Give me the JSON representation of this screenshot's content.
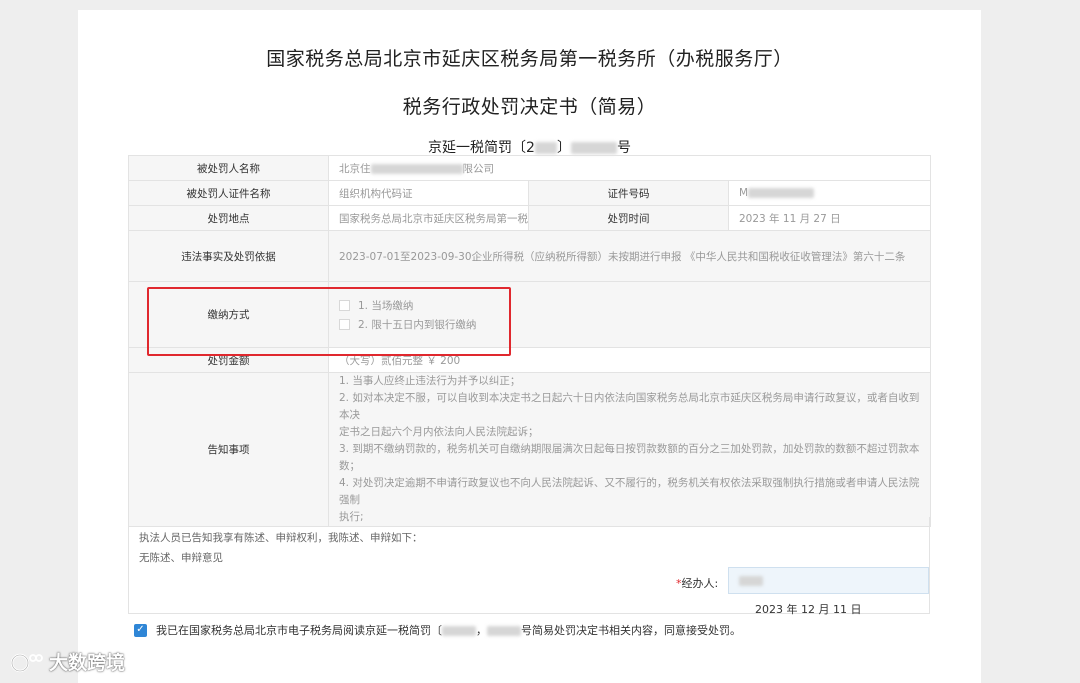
{
  "header": {
    "office": "国家税务总局北京市延庆区税务局第一税务所（办税服务厅）",
    "doc_title": "税务行政处罚决定书（简易）",
    "doc_no_prefix": "京延一税简罚〔2",
    "doc_no_suffix": "号"
  },
  "form": {
    "name_label": "被处罚人名称",
    "name_prefix": "北京住",
    "name_suffix": "限公司",
    "cert_name_label": "被处罚人证件名称",
    "cert_name_value": "组织机构代码证",
    "cert_no_label": "证件号码",
    "cert_no_prefix": "M",
    "place_label": "处罚地点",
    "place_value": "国家税务总局北京市延庆区税务局第一税务",
    "time_label": "处罚时间",
    "time_value": "2023 年 11 月 27 日",
    "violation_label": "违法事实及处罚依据",
    "violation_value": "2023-07-01至2023-09-30企业所得税（应纳税所得额）未按期进行申报 《中华人民共和国税收征收管理法》第六十二条",
    "pay_label": "缴纳方式",
    "pay_options": [
      "1. 当场缴纳",
      "2. 限十五日内到银行缴纳"
    ],
    "amount_label": "处罚金额",
    "amount_value": "（大写）贰佰元整  ￥ 200",
    "notice_label": "告知事项",
    "notice_lines": [
      "1. 当事人应终止违法行为并予以纠正；",
      "2. 如对本决定不服，可以自收到本决定书之日起六十日内依法向国家税务总局北京市延庆区税务局申请行政复议，或者自收到本决",
      "定书之日起六个月内依法向人民法院起诉；",
      "3. 到期不缴纳罚款的，税务机关可自缴纳期限届满次日起每日按罚款数额的百分之三加处罚款，加处罚款的数额不超过罚款本数；",
      "4. 对处罚决定逾期不申请行政复议也不向人民法院起诉、又不履行的，税务机关有权依法采取强制执行措施或者申请人民法院强制",
      "执行;"
    ]
  },
  "statement": {
    "line1": "执法人员已告知我享有陈述、申辩权利，我陈述、申辩如下：",
    "line2": "无陈述、申辩意见",
    "handler_required": "*",
    "handler_label": "经办人:",
    "handler_value": "",
    "date": "2023 年 12 月 11 日"
  },
  "agreement": {
    "text_prefix": "我已在国家税务总局北京市电子税务局阅读京延一税简罚〔",
    "text_suffix": "号简易处罚决定书相关内容，同意接受处罚。",
    "checked": true
  },
  "watermark": {
    "text": "大数跨境"
  },
  "colors": {
    "highlight_border": "#e0282e",
    "checkbox_blue": "#2f86d6",
    "input_bg": "#eef5fb"
  }
}
